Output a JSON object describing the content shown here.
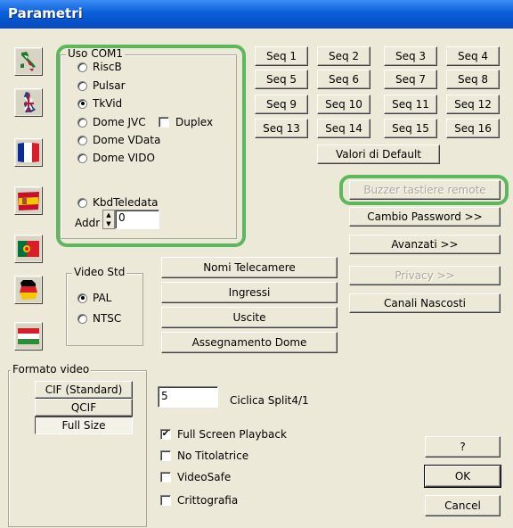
{
  "window": {
    "title": "Parametri"
  },
  "com1": {
    "label": "Uso COM1",
    "options": [
      "RiscB",
      "Pulsar",
      "TkVid",
      "Dome JVC",
      "Dome VData",
      "Dome VIDO",
      "KbdTeledata"
    ],
    "selected": "TkVid",
    "duplex_label": "Duplex",
    "duplex_checked": false,
    "addr_label": "Addr",
    "addr_value": "0"
  },
  "seq_buttons": [
    "Seq 1",
    "Seq 2",
    "Seq 3",
    "Seq 4",
    "Seq 5",
    "Seq 6",
    "Seq 7",
    "Seq 8",
    "Seq 9",
    "Seq 10",
    "Seq 11",
    "Seq 12",
    "Seq 13",
    "Seq 14",
    "Seq 15",
    "Seq 16"
  ],
  "buttons": {
    "defaults": "Valori di Default",
    "buzzer": "Buzzer tastiere remote",
    "password": "Cambio Password >>",
    "advanced": "Avanzati >>",
    "privacy": "Privacy >>",
    "hidden_channels": "Canali Nascosti",
    "camera_names": "Nomi Telecamere",
    "inputs": "Ingressi",
    "outputs": "Uscite",
    "dome_assign": "Assegnamento Dome",
    "help": "?",
    "ok": "OK",
    "cancel": "Cancel"
  },
  "video_std": {
    "label": "Video Std",
    "options": [
      "PAL",
      "NTSC"
    ],
    "selected": "PAL"
  },
  "formato_video": {
    "label": "Formato video",
    "options": [
      "CIF (Standard)",
      "QCIF",
      "Full Size"
    ],
    "selected": "Full Size"
  },
  "split": {
    "value": "5",
    "label": "Ciclica Split4/1"
  },
  "checks": [
    {
      "label": "Full Screen Playback",
      "checked": true
    },
    {
      "label": "No Titolatrice",
      "checked": false
    },
    {
      "label": "VideoSafe",
      "checked": false
    },
    {
      "label": "Crittografia",
      "checked": false
    }
  ],
  "flags": [
    "italy-flag-icon",
    "uk-flag-icon",
    "france-flag-icon",
    "spain-flag-icon",
    "portugal-flag-icon",
    "germany-flag-icon",
    "hungary-flag-icon"
  ],
  "highlight_color": "#5cb85c"
}
